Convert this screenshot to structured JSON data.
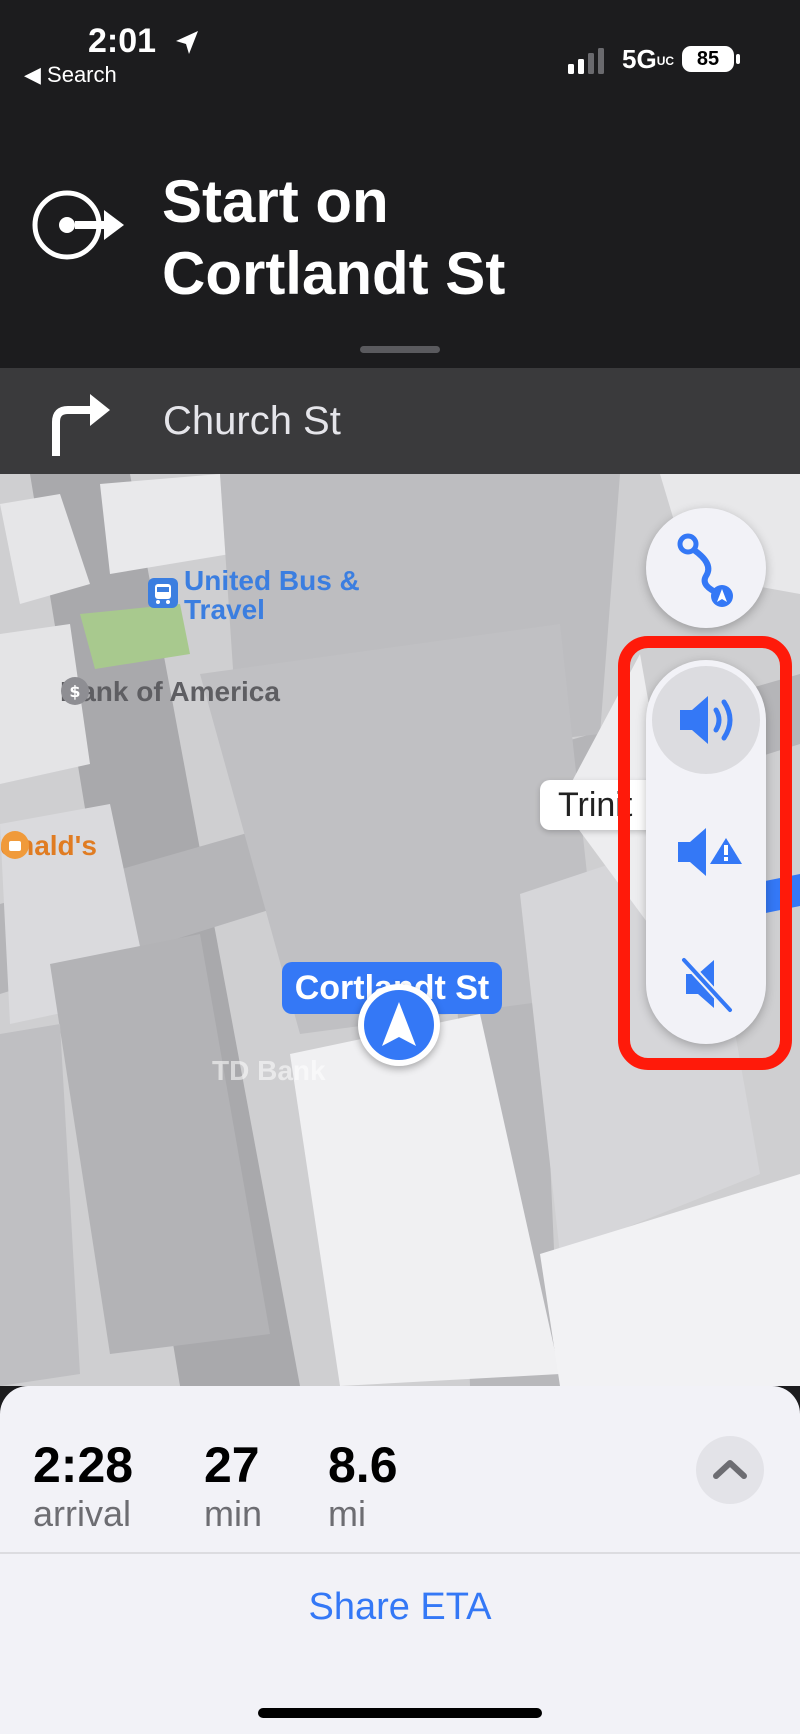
{
  "status_bar": {
    "time": "2:01",
    "back_label": "◀ Search",
    "network": "5G",
    "network_suffix": "UC",
    "battery": "85",
    "icons": [
      "location-arrow-icon",
      "signal-icon",
      "battery-icon"
    ]
  },
  "navigation": {
    "instruction_line1": "Start on",
    "instruction_line2": "Cortlandt St",
    "maneuver_icon": "start-arrow-icon",
    "next_street": "Church St",
    "next_icon": "turn-right-icon"
  },
  "map": {
    "current_street_label": "Cortlandt St",
    "pois": {
      "bus": "United Bus & Travel",
      "bus_line1": "United Bus &",
      "bus_line2": "Travel",
      "bank": "Bank of America",
      "mcdonalds": "onald's",
      "td_bank": "TD Bank",
      "trinity": "Trinit"
    },
    "colors": {
      "route_blue": "#3478f6",
      "highlight_red": "#ff1a0a"
    }
  },
  "audio_options": [
    {
      "name": "voice-on",
      "icon": "speaker-wave-icon",
      "selected": true
    },
    {
      "name": "alerts-only",
      "icon": "speaker-alert-icon",
      "selected": false
    },
    {
      "name": "muted",
      "icon": "speaker-mute-icon",
      "selected": false
    }
  ],
  "trip": {
    "arrival_value": "2:28",
    "arrival_label": "arrival",
    "duration_value": "27",
    "duration_label": "min",
    "distance_value": "8.6",
    "distance_label": "mi",
    "share_label": "Share ETA"
  }
}
